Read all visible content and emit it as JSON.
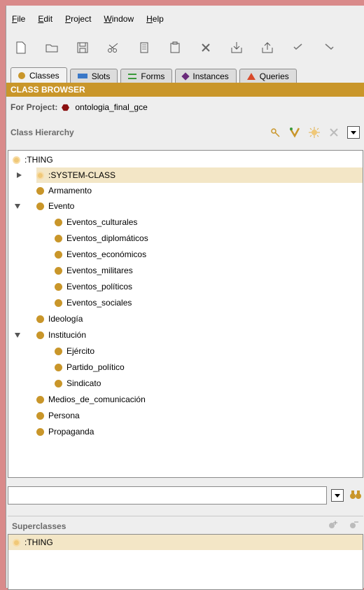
{
  "menubar": {
    "items": [
      {
        "label": "File",
        "ul": "F",
        "rest": "ile"
      },
      {
        "label": "Edit",
        "ul": "E",
        "rest": "dit"
      },
      {
        "label": "Project",
        "ul": "P",
        "rest": "roject"
      },
      {
        "label": "Window",
        "ul": "W",
        "rest": "indow"
      },
      {
        "label": "Help",
        "ul": "H",
        "rest": "elp"
      }
    ]
  },
  "toolbar": {
    "icons": [
      "new-file-icon",
      "open-folder-icon",
      "save-icon",
      "cut-icon",
      "copy-icon",
      "paste-icon",
      "delete-icon",
      "import-icon",
      "export-icon",
      "undo-icon",
      "redo-icon"
    ]
  },
  "tabs": [
    {
      "label": "Classes",
      "color": "#c9962a",
      "shape": "circle",
      "active": true
    },
    {
      "label": "Slots",
      "color": "#3a78c8",
      "shape": "rect",
      "active": false
    },
    {
      "label": "Forms",
      "color": "#3a9a3a",
      "shape": "lines",
      "active": false
    },
    {
      "label": "Instances",
      "color": "#6a2a7a",
      "shape": "diamond",
      "active": false
    },
    {
      "label": "Queries",
      "color": "#d84a2a",
      "shape": "triangle",
      "active": false
    }
  ],
  "class_browser": {
    "title": "CLASS BROWSER",
    "project_label": "For Project:",
    "project_name": "ontologia_final_gce",
    "hierarchy_title": "Class Hierarchy"
  },
  "tree": {
    "root": ":THING",
    "items": [
      {
        "label": ":SYSTEM-CLASS",
        "level": 1,
        "twist": "collapsed",
        "light": true,
        "selected": true
      },
      {
        "label": "Armamento",
        "level": 1,
        "twist": "",
        "light": false
      },
      {
        "label": "Evento",
        "level": 1,
        "twist": "expanded",
        "light": false
      },
      {
        "label": "Eventos_culturales",
        "level": 2,
        "twist": "",
        "light": false
      },
      {
        "label": "Eventos_diplomáticos",
        "level": 2,
        "twist": "",
        "light": false
      },
      {
        "label": "Eventos_económicos",
        "level": 2,
        "twist": "",
        "light": false
      },
      {
        "label": "Eventos_militares",
        "level": 2,
        "twist": "",
        "light": false
      },
      {
        "label": "Eventos_políticos",
        "level": 2,
        "twist": "",
        "light": false
      },
      {
        "label": "Eventos_sociales",
        "level": 2,
        "twist": "",
        "light": false
      },
      {
        "label": "Ideología",
        "level": 1,
        "twist": "",
        "light": false
      },
      {
        "label": "Institución",
        "level": 1,
        "twist": "expanded",
        "light": false
      },
      {
        "label": "Ejército",
        "level": 2,
        "twist": "",
        "light": false
      },
      {
        "label": "Partido_político",
        "level": 2,
        "twist": "",
        "light": false
      },
      {
        "label": "Sindicato",
        "level": 2,
        "twist": "",
        "light": false
      },
      {
        "label": "Medios_de_comunicación",
        "level": 1,
        "twist": "",
        "light": false
      },
      {
        "label": "Persona",
        "level": 1,
        "twist": "",
        "light": false
      },
      {
        "label": "Propaganda",
        "level": 1,
        "twist": "",
        "light": false
      }
    ]
  },
  "search": {
    "value": "",
    "placeholder": ""
  },
  "superclasses": {
    "title": "Superclasses",
    "items": [
      ":THING"
    ]
  },
  "colors": {
    "accent": "#c9962a",
    "selection": "#f3e6c6"
  }
}
